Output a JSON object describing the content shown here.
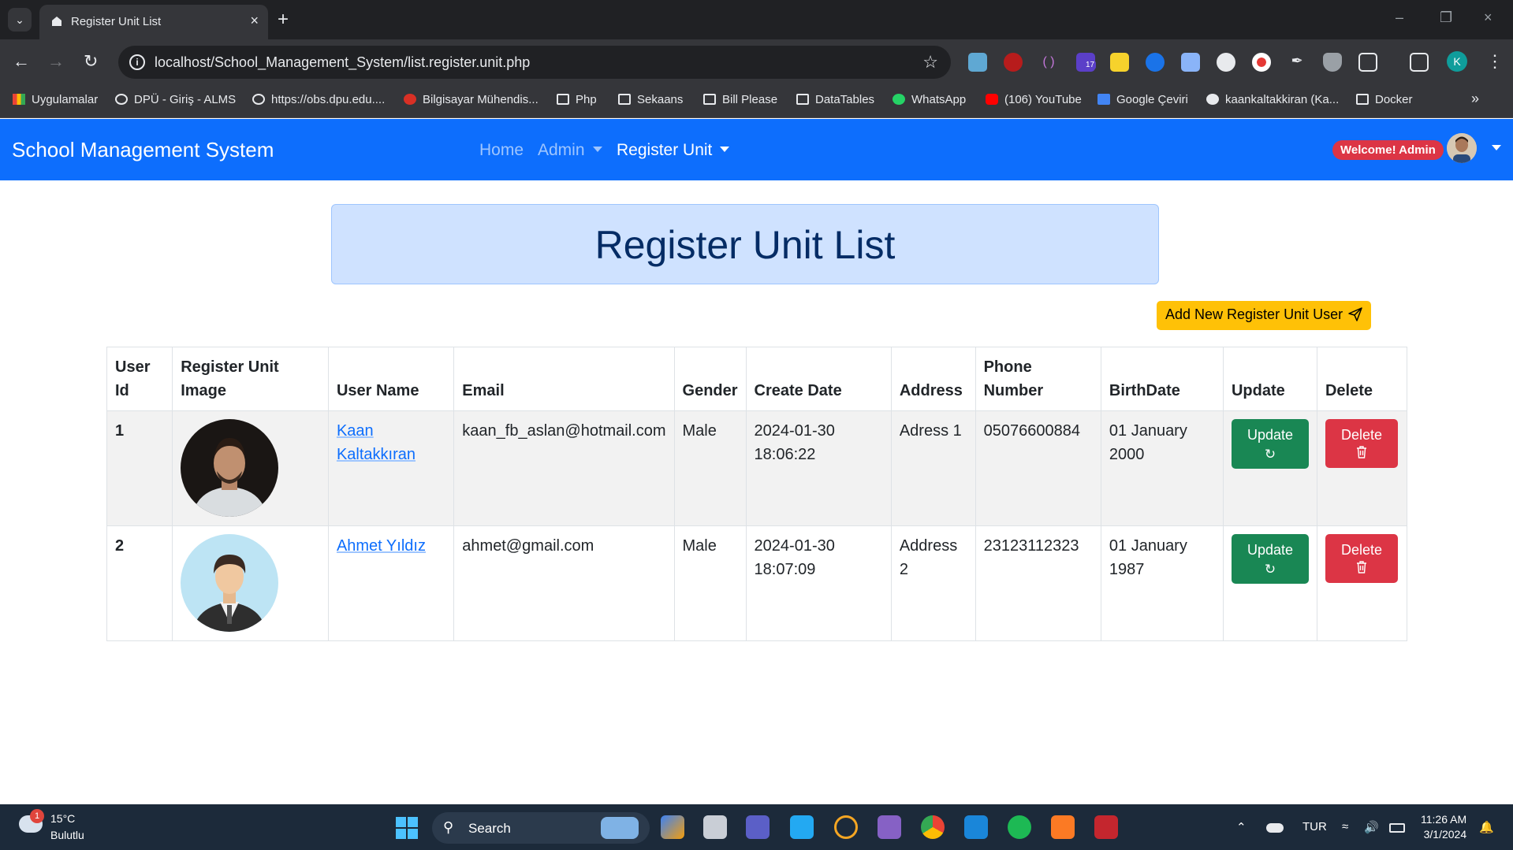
{
  "browser": {
    "tab_title": "Register Unit List",
    "url": "localhost/School_Management_System/list.register.unit.php",
    "bookmarks": [
      {
        "label": "Uygulamalar",
        "icon": "apps-grid-icon"
      },
      {
        "label": "DPÜ - Giriş - ALMS",
        "icon": "globe-icon"
      },
      {
        "label": "https://obs.dpu.edu....",
        "icon": "globe-icon"
      },
      {
        "label": "Bilgisayar Mühendis...",
        "icon": "site-icon"
      },
      {
        "label": "Php",
        "icon": "folder-icon"
      },
      {
        "label": "Sekaans",
        "icon": "folder-icon"
      },
      {
        "label": "Bill Please",
        "icon": "folder-icon"
      },
      {
        "label": "DataTables",
        "icon": "folder-icon"
      },
      {
        "label": "WhatsApp",
        "icon": "whatsapp-icon"
      },
      {
        "label": "(106) YouTube",
        "icon": "youtube-icon"
      },
      {
        "label": "Google Çeviri",
        "icon": "google-translate-icon"
      },
      {
        "label": "kaankaltakkiran (Ka...",
        "icon": "github-icon"
      },
      {
        "label": "Docker",
        "icon": "folder-icon"
      }
    ],
    "extension_badge": "17",
    "profile_initial": "K"
  },
  "navbar": {
    "brand": "School Management System",
    "links": [
      "Home",
      "Admin",
      "Register Unit"
    ],
    "welcome": "Welcome! Admin"
  },
  "page": {
    "title": "Register Unit List",
    "add_button": "Add New Register Unit User"
  },
  "table": {
    "headers": [
      "User Id",
      "Register Unit Image",
      "User Name",
      "Email",
      "Gender",
      "Create Date",
      "Address",
      "Phone Number",
      "BirthDate",
      "Update",
      "Delete"
    ],
    "rows": [
      {
        "id": "1",
        "name": "Kaan Kaltakkıran",
        "email": "kaan_fb_aslan@hotmail.com",
        "gender": "Male",
        "created": "2024-01-30 18:06:22",
        "address": "Adress 1",
        "phone": "05076600884",
        "birthdate": "01 January 2000",
        "update": "Update",
        "delete": "Delete"
      },
      {
        "id": "2",
        "name": "Ahmet Yıldız",
        "email": "ahmet@gmail.com",
        "gender": "Male",
        "created": "2024-01-30 18:07:09",
        "address": "Address 2",
        "phone": "23123112323",
        "birthdate": "01 January 1987",
        "update": "Update",
        "delete": "Delete"
      }
    ]
  },
  "taskbar": {
    "weather_badge": "1",
    "temperature": "15°C",
    "condition": "Bulutlu",
    "search": "Search",
    "language": "TUR",
    "time": "11:26 AM",
    "date": "3/1/2024"
  },
  "colors": {
    "primary": "#0d6efd",
    "success": "#198754",
    "danger": "#dc3545",
    "warning": "#ffc107",
    "hero_bg": "#cfe2ff"
  }
}
